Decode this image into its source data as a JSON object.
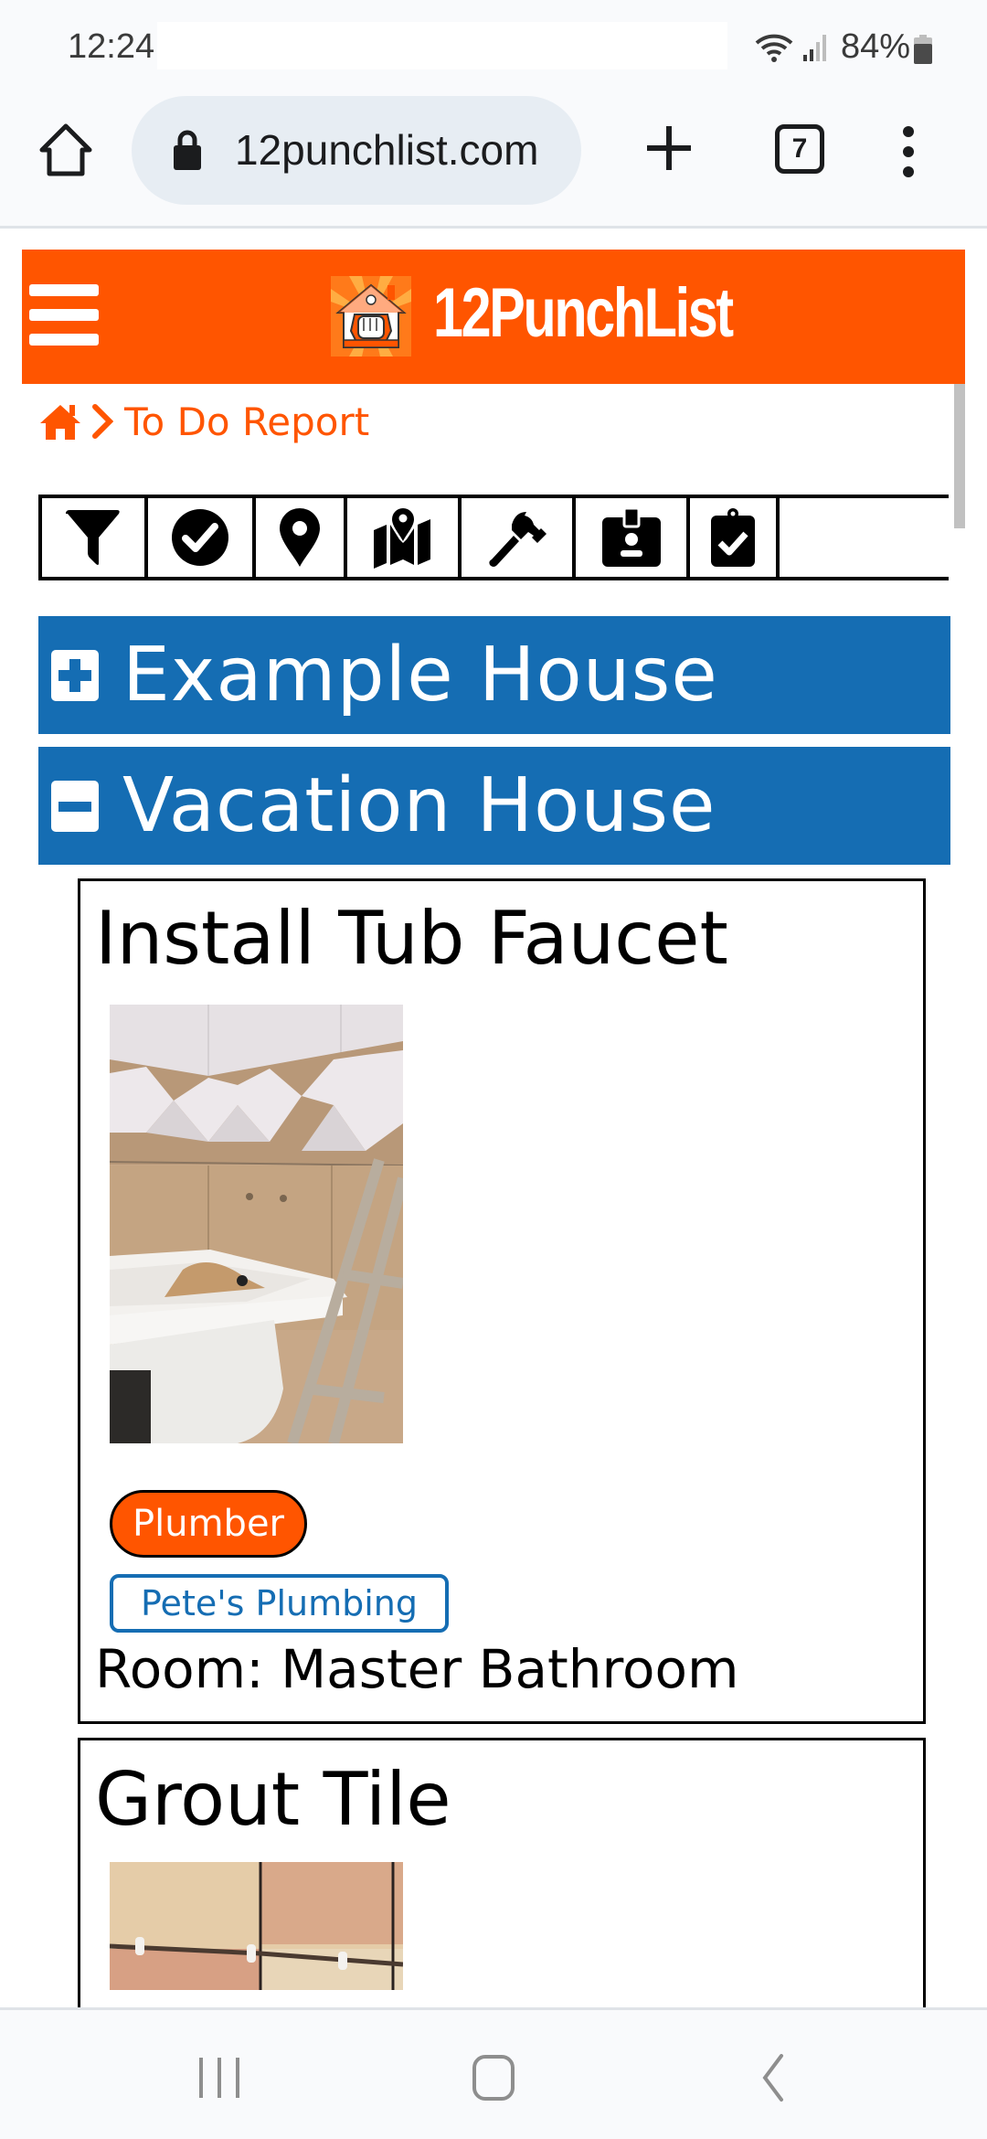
{
  "status_bar": {
    "time": "12:24",
    "battery_percent": "84%",
    "icons": [
      "wifi-icon",
      "signal-icon",
      "battery-icon"
    ]
  },
  "browser": {
    "url": "12punchlist.com",
    "tab_count": "7",
    "icons": [
      "home-icon",
      "lock-icon",
      "new-tab-icon",
      "tab-switcher-icon",
      "more-menu-icon"
    ]
  },
  "header": {
    "brand": "12PunchList",
    "brand_color": "#ff5500",
    "menu_icon": "hamburger-icon",
    "logo_icon": "house-fist-logo"
  },
  "breadcrumb": {
    "home_icon": "home-icon",
    "separator_icon": "chevron-right-icon",
    "current": "To Do Report"
  },
  "filter_toolbar": {
    "buttons": [
      {
        "icon": "filter-icon",
        "label": "Filter"
      },
      {
        "icon": "check-circle-icon",
        "label": "Status"
      },
      {
        "icon": "map-marker-icon",
        "label": "Location"
      },
      {
        "icon": "map-icon",
        "label": "Map"
      },
      {
        "icon": "hammer-icon",
        "label": "Trade"
      },
      {
        "icon": "id-badge-icon",
        "label": "Vendor"
      },
      {
        "icon": "clipboard-check-icon",
        "label": "Tasks"
      }
    ]
  },
  "sections": [
    {
      "title": "Example House",
      "expanded": false,
      "toggle_icon": "plus-square-icon"
    },
    {
      "title": "Vacation House",
      "expanded": true,
      "toggle_icon": "minus-square-icon"
    }
  ],
  "accent_color": "#156db3",
  "tasks": [
    {
      "title": "Install Tub Faucet",
      "photo": "bathroom tub with tiled wall and ladder",
      "trade": "Plumber",
      "vendor": "Pete's Plumbing",
      "room": "Room: Master Bathroom"
    },
    {
      "title": "Grout Tile",
      "photo": "tiles with spacers"
    }
  ],
  "nav_bar": {
    "buttons": [
      "recent-apps-icon",
      "home-circle-icon",
      "back-icon"
    ]
  }
}
